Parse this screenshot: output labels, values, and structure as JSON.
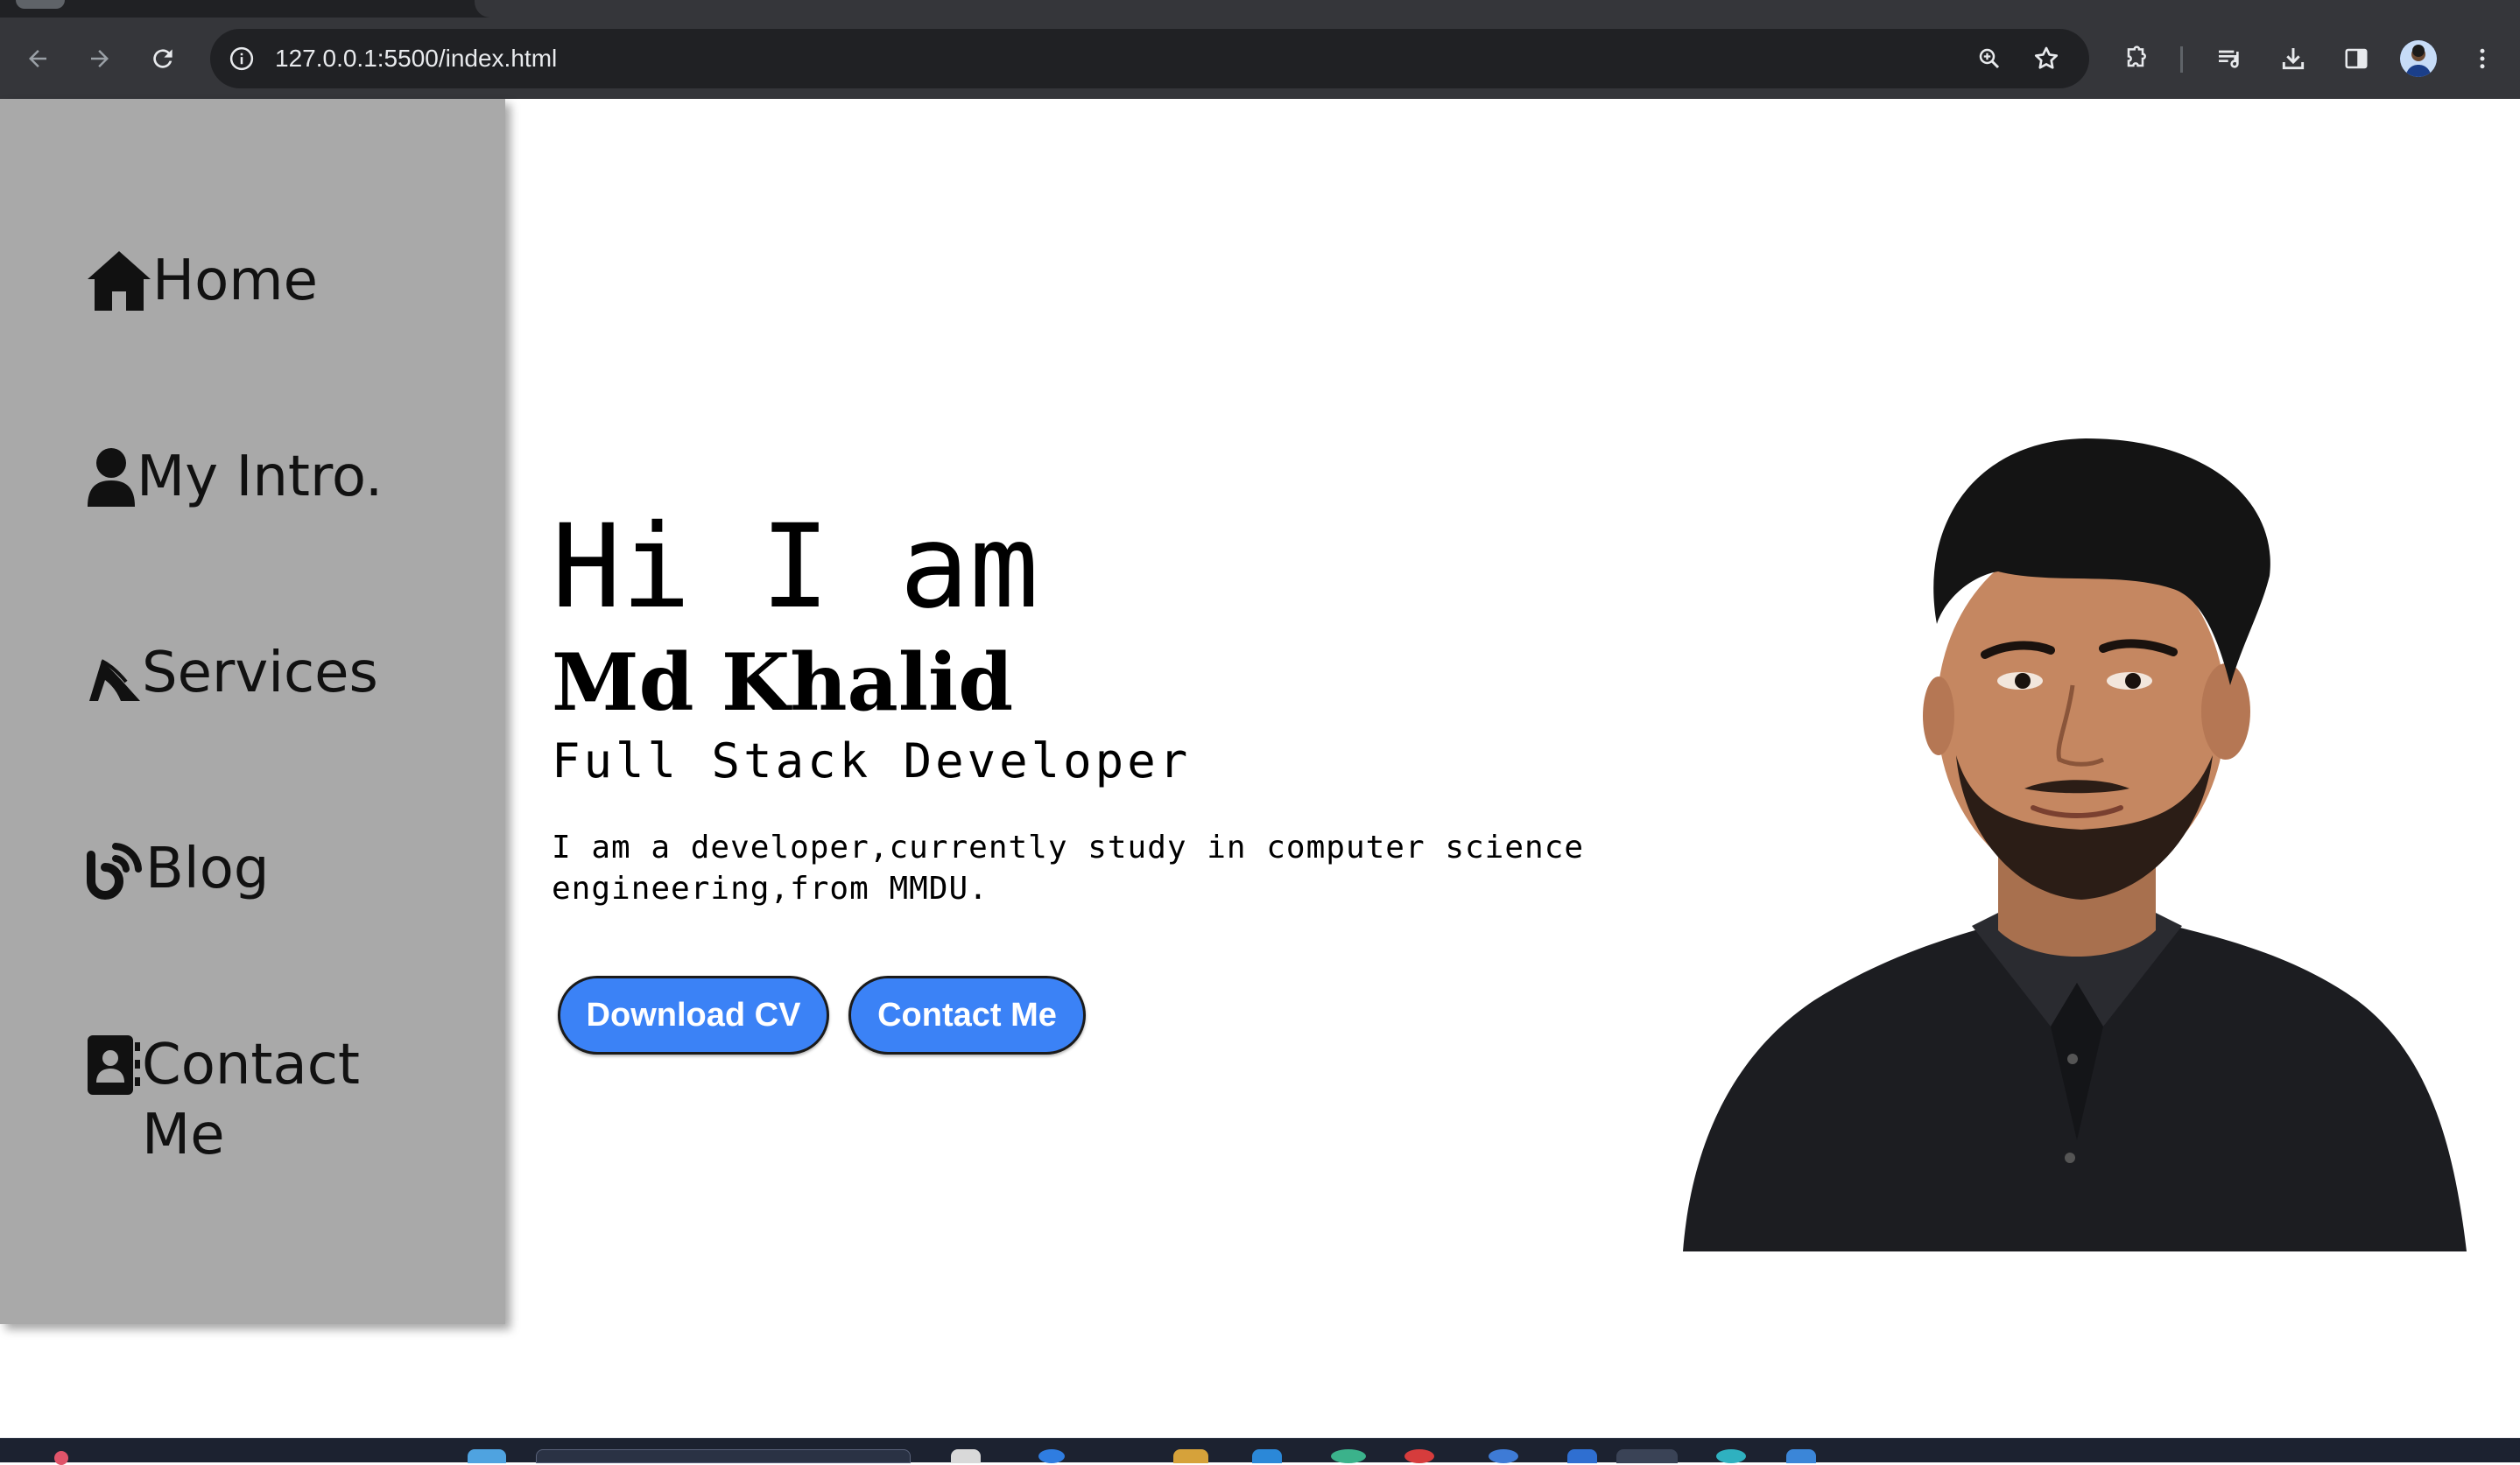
{
  "browser": {
    "url": "127.0.0.1:5500/index.html",
    "icons": [
      "back-arrow-icon",
      "forward-arrow-icon",
      "reload-icon",
      "site-info-icon",
      "zoom-icon",
      "bookmark-star-icon",
      "extensions-icon",
      "media-queue-icon",
      "download-icon",
      "side-panel-icon",
      "profile-avatar",
      "more-menu-icon"
    ]
  },
  "sidebar": {
    "items": [
      {
        "label": "Home",
        "icon": "house-icon"
      },
      {
        "label": "My Intro.",
        "icon": "user-icon"
      },
      {
        "label": "Services",
        "icon": "services-icon"
      },
      {
        "label": "Blog",
        "icon": "blog-icon"
      },
      {
        "label": "Contact Me",
        "icon": "contact-book-icon"
      }
    ],
    "background": "#a9a9a9"
  },
  "hero": {
    "greeting": "Hi I am",
    "name": "Md Khalid",
    "role": "Full Stack Developer",
    "bio": "I am a developer,currently study in computer science engineering,from MMDU.",
    "buttons": {
      "download_cv": "Download CV",
      "contact_me": "Contact Me"
    },
    "button_color": "#3b82f6"
  },
  "colors": {
    "chrome_dark": "#35363a",
    "omnibox": "#202124",
    "taskbar": "#1c2230"
  }
}
